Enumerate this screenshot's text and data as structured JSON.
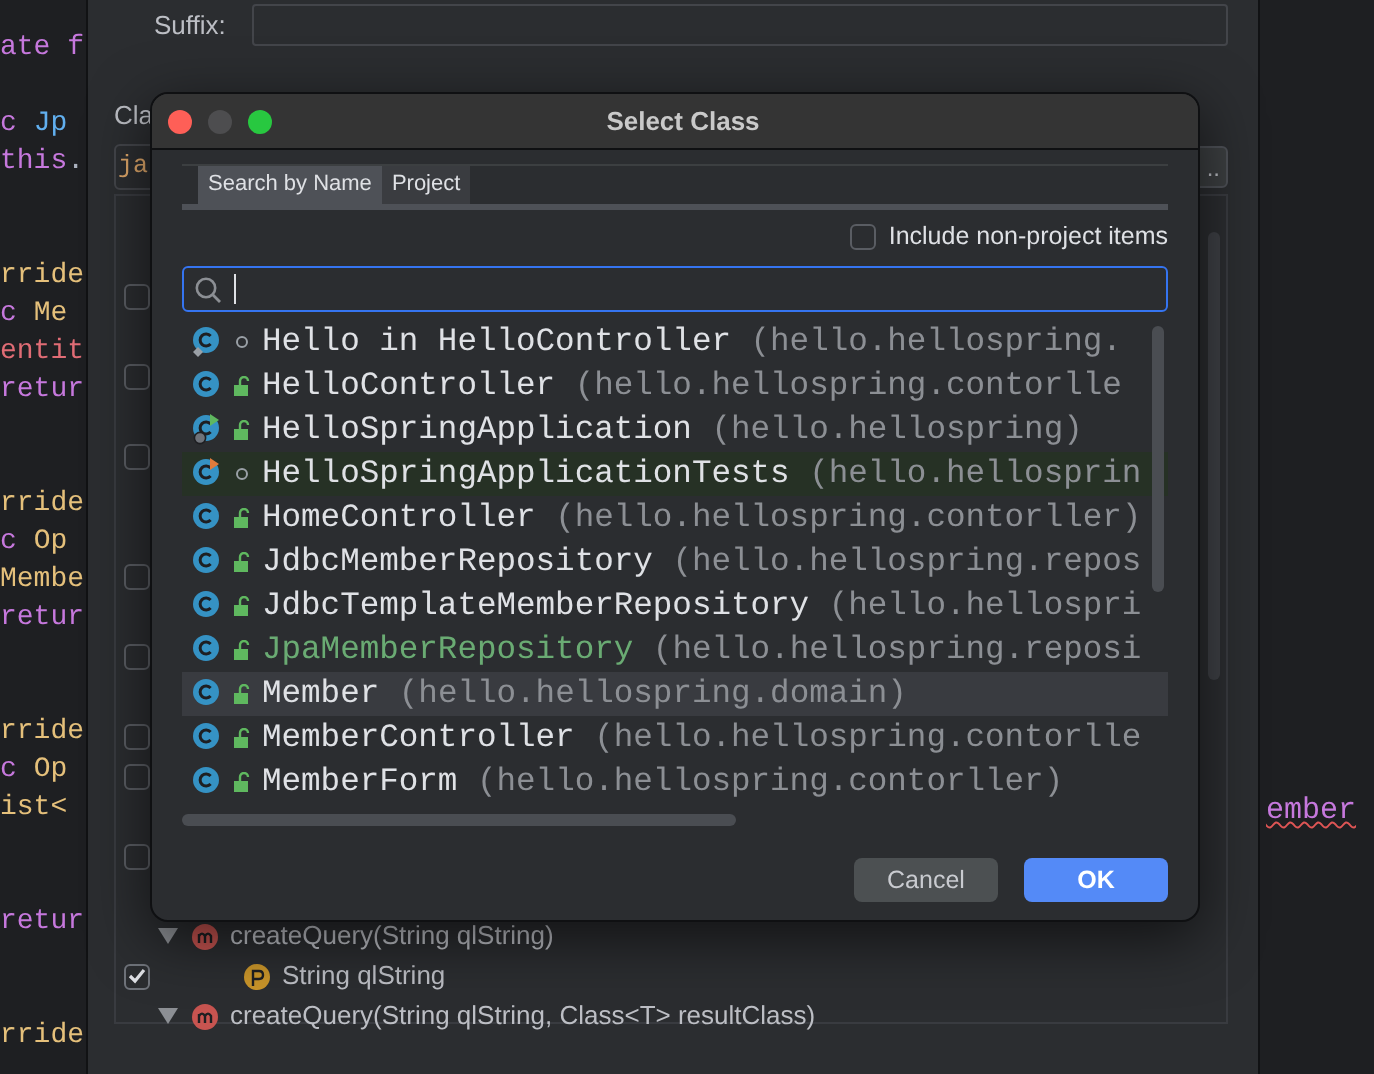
{
  "editor": {
    "lines": [
      {
        "kind": "code",
        "tokens": [
          {
            "text": "ate f",
            "color": "#c678dd"
          }
        ]
      },
      {
        "kind": "blank"
      },
      {
        "kind": "code",
        "tokens": [
          {
            "text": "c ",
            "color": "#c678dd"
          },
          {
            "text": "Jp",
            "color": "#61afef"
          }
        ]
      },
      {
        "kind": "code",
        "tokens": [
          {
            "text": "this",
            "color": "#c678dd"
          },
          {
            "text": ".",
            "color": "#abb2bf"
          }
        ]
      },
      {
        "kind": "blank"
      },
      {
        "kind": "blank"
      },
      {
        "kind": "code",
        "tokens": [
          {
            "text": "rride",
            "color": "#e5c07b"
          }
        ]
      },
      {
        "kind": "code",
        "tokens": [
          {
            "text": "c ",
            "color": "#c678dd"
          },
          {
            "text": "Me",
            "color": "#e5c07b"
          }
        ]
      },
      {
        "kind": "code",
        "tokens": [
          {
            "text": "entit",
            "color": "#e06c75"
          }
        ]
      },
      {
        "kind": "code",
        "tokens": [
          {
            "text": "retur",
            "color": "#c678dd"
          }
        ]
      },
      {
        "kind": "blank"
      },
      {
        "kind": "blank"
      },
      {
        "kind": "code",
        "tokens": [
          {
            "text": "rride",
            "color": "#e5c07b"
          }
        ]
      },
      {
        "kind": "code",
        "tokens": [
          {
            "text": "c ",
            "color": "#c678dd"
          },
          {
            "text": "Op",
            "color": "#e5c07b"
          }
        ]
      },
      {
        "kind": "code",
        "tokens": [
          {
            "text": "Membe",
            "color": "#e5c07b"
          }
        ]
      },
      {
        "kind": "code",
        "tokens": [
          {
            "text": "retur",
            "color": "#c678dd"
          }
        ]
      },
      {
        "kind": "blank"
      },
      {
        "kind": "blank"
      },
      {
        "kind": "code",
        "tokens": [
          {
            "text": "rride",
            "color": "#e5c07b"
          }
        ]
      },
      {
        "kind": "code",
        "tokens": [
          {
            "text": "c ",
            "color": "#c678dd"
          },
          {
            "text": "Op",
            "color": "#e5c07b"
          }
        ]
      },
      {
        "kind": "code",
        "tokens": [
          {
            "text": "ist<",
            "color": "#e5c07b"
          }
        ]
      },
      {
        "kind": "blank"
      },
      {
        "kind": "blank"
      },
      {
        "kind": "code",
        "tokens": [
          {
            "text": "retur",
            "color": "#c678dd"
          }
        ]
      },
      {
        "kind": "blank"
      },
      {
        "kind": "blank"
      },
      {
        "kind": "code",
        "tokens": [
          {
            "text": "rride",
            "color": "#e5c07b"
          }
        ]
      }
    ]
  },
  "form": {
    "suffix_label": "Suffix:",
    "class_label": "Cla",
    "class_value": "ja",
    "browse_button": "..",
    "tree": {
      "rows": [
        {
          "kind": "check",
          "checked": false
        },
        {
          "kind": "spacer"
        },
        {
          "kind": "check",
          "checked": false
        },
        {
          "kind": "spacer"
        },
        {
          "kind": "check",
          "checked": false
        },
        {
          "kind": "spacer"
        },
        {
          "kind": "spacer"
        },
        {
          "kind": "check",
          "checked": false
        },
        {
          "kind": "spacer"
        },
        {
          "kind": "check",
          "checked": false
        },
        {
          "kind": "spacer"
        },
        {
          "kind": "check",
          "checked": false
        },
        {
          "kind": "check",
          "checked": false
        },
        {
          "kind": "spacer"
        },
        {
          "kind": "check",
          "checked": false
        },
        {
          "kind": "spacer"
        },
        {
          "kind": "method",
          "expanded": true,
          "label": "createQuery(String qlString)"
        },
        {
          "kind": "param",
          "checked": true,
          "label": "String qlString"
        },
        {
          "kind": "method",
          "expanded": true,
          "label": "createQuery(String qlString, Class<T> resultClass)"
        }
      ]
    }
  },
  "side_text": "ember",
  "dialog": {
    "title": "Select Class",
    "tabs": [
      {
        "label": "Search by Name",
        "selected": true
      },
      {
        "label": "Project",
        "selected": false
      }
    ],
    "include_option": {
      "label": "Include non-project items",
      "checked": false
    },
    "results": [
      {
        "kind": "inner",
        "public": false,
        "name": "Hello in HelloController",
        "package": "(hello.hellospring.",
        "color": "#dfe1e5",
        "selected": false
      },
      {
        "kind": "class",
        "public": true,
        "name": "HelloController",
        "package": "(hello.hellospring.contorlle",
        "color": "#dfe1e5",
        "selected": false
      },
      {
        "kind": "app",
        "public": true,
        "name": "HelloSpringApplication",
        "package": "(hello.hellospring)",
        "color": "#dfe1e5",
        "selected": false
      },
      {
        "kind": "test",
        "public": false,
        "name": "HelloSpringApplicationTests",
        "package": "(hello.hellosprin",
        "color": "#dfe1e5",
        "selected": false
      },
      {
        "kind": "class",
        "public": true,
        "name": "HomeController",
        "package": "(hello.hellospring.contorller)",
        "color": "#dfe1e5",
        "selected": false
      },
      {
        "kind": "class",
        "public": true,
        "name": "JdbcMemberRepository",
        "package": "(hello.hellospring.repos",
        "color": "#dfe1e5",
        "selected": false
      },
      {
        "kind": "class",
        "public": true,
        "name": "JdbcTemplateMemberRepository",
        "package": "(hello.hellospri",
        "color": "#dfe1e5",
        "selected": false
      },
      {
        "kind": "class",
        "public": true,
        "name": "JpaMemberRepository",
        "package": "(hello.hellospring.reposi",
        "color": "#6aab73",
        "selected": false
      },
      {
        "kind": "class",
        "public": true,
        "name": "Member",
        "package": "(hello.hellospring.domain)",
        "color": "#dfe1e5",
        "selected": true
      },
      {
        "kind": "class",
        "public": true,
        "name": "MemberController",
        "package": "(hello.hellospring.contorlle",
        "color": "#dfe1e5",
        "selected": false
      },
      {
        "kind": "class",
        "public": true,
        "name": "MemberForm",
        "package": "(hello.hellospring.contorller)",
        "color": "#dfe1e5",
        "selected": false
      }
    ],
    "buttons": [
      {
        "label": "Cancel",
        "kind": "secondary"
      },
      {
        "label": "OK",
        "kind": "primary"
      }
    ]
  }
}
